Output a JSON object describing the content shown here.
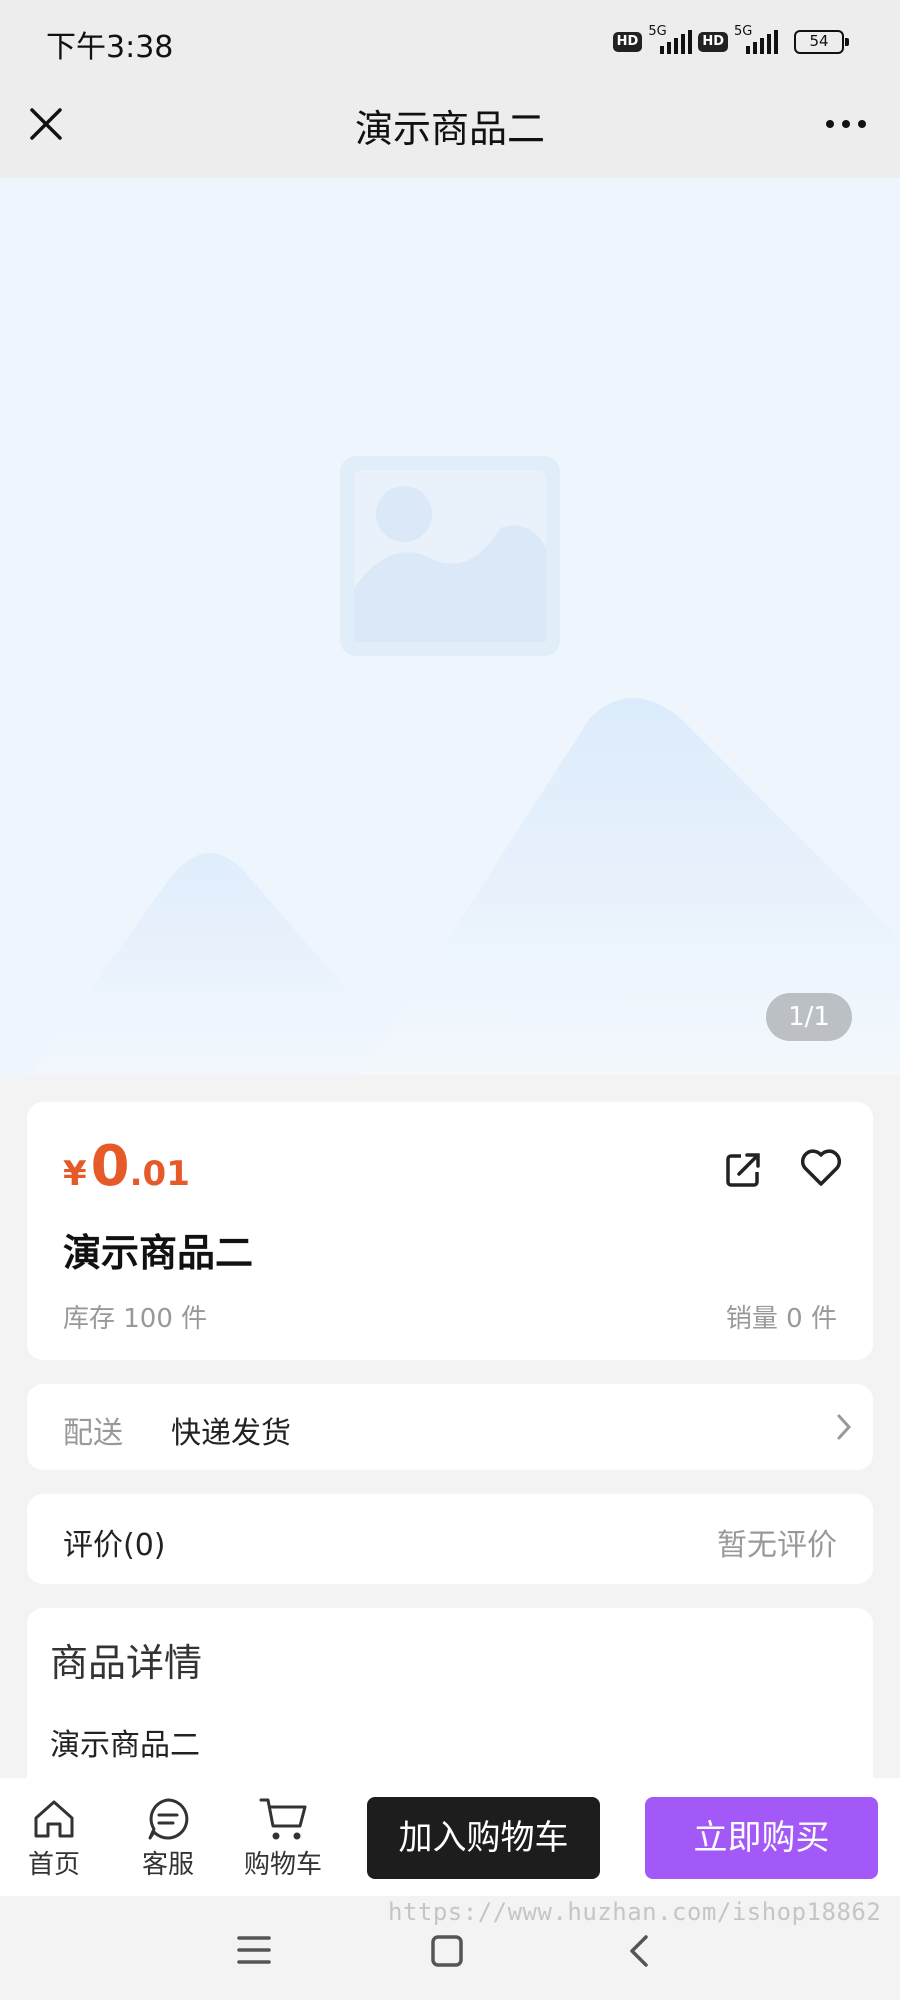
{
  "status_bar": {
    "time": "下午3:38",
    "network_badge": "HD",
    "network_type": "5G",
    "battery": "54"
  },
  "nav": {
    "title": "演示商品二",
    "close_icon": "close-icon",
    "more_icon": "more-icon"
  },
  "gallery": {
    "pager": "1/1",
    "image_icon": "image-placeholder-icon"
  },
  "product": {
    "currency": "¥",
    "price_int": "0",
    "price_dec": ".01",
    "name": "演示商品二",
    "stock": "库存 100 件",
    "sales": "销量 0 件",
    "accent_color": "#e65a2a"
  },
  "delivery": {
    "label": "配送",
    "value": "快递发货"
  },
  "review": {
    "label": "评价(0)",
    "empty": "暂无评价"
  },
  "detail": {
    "heading": "商品详情",
    "body": "演示商品二"
  },
  "bottom_bar": {
    "home": "首页",
    "service": "客服",
    "cart": "购物车",
    "add_to_cart": "加入购物车",
    "buy_now": "立即购买",
    "buy_color": "#a259f7"
  },
  "watermark": "https://www.huzhan.com/ishop18862"
}
